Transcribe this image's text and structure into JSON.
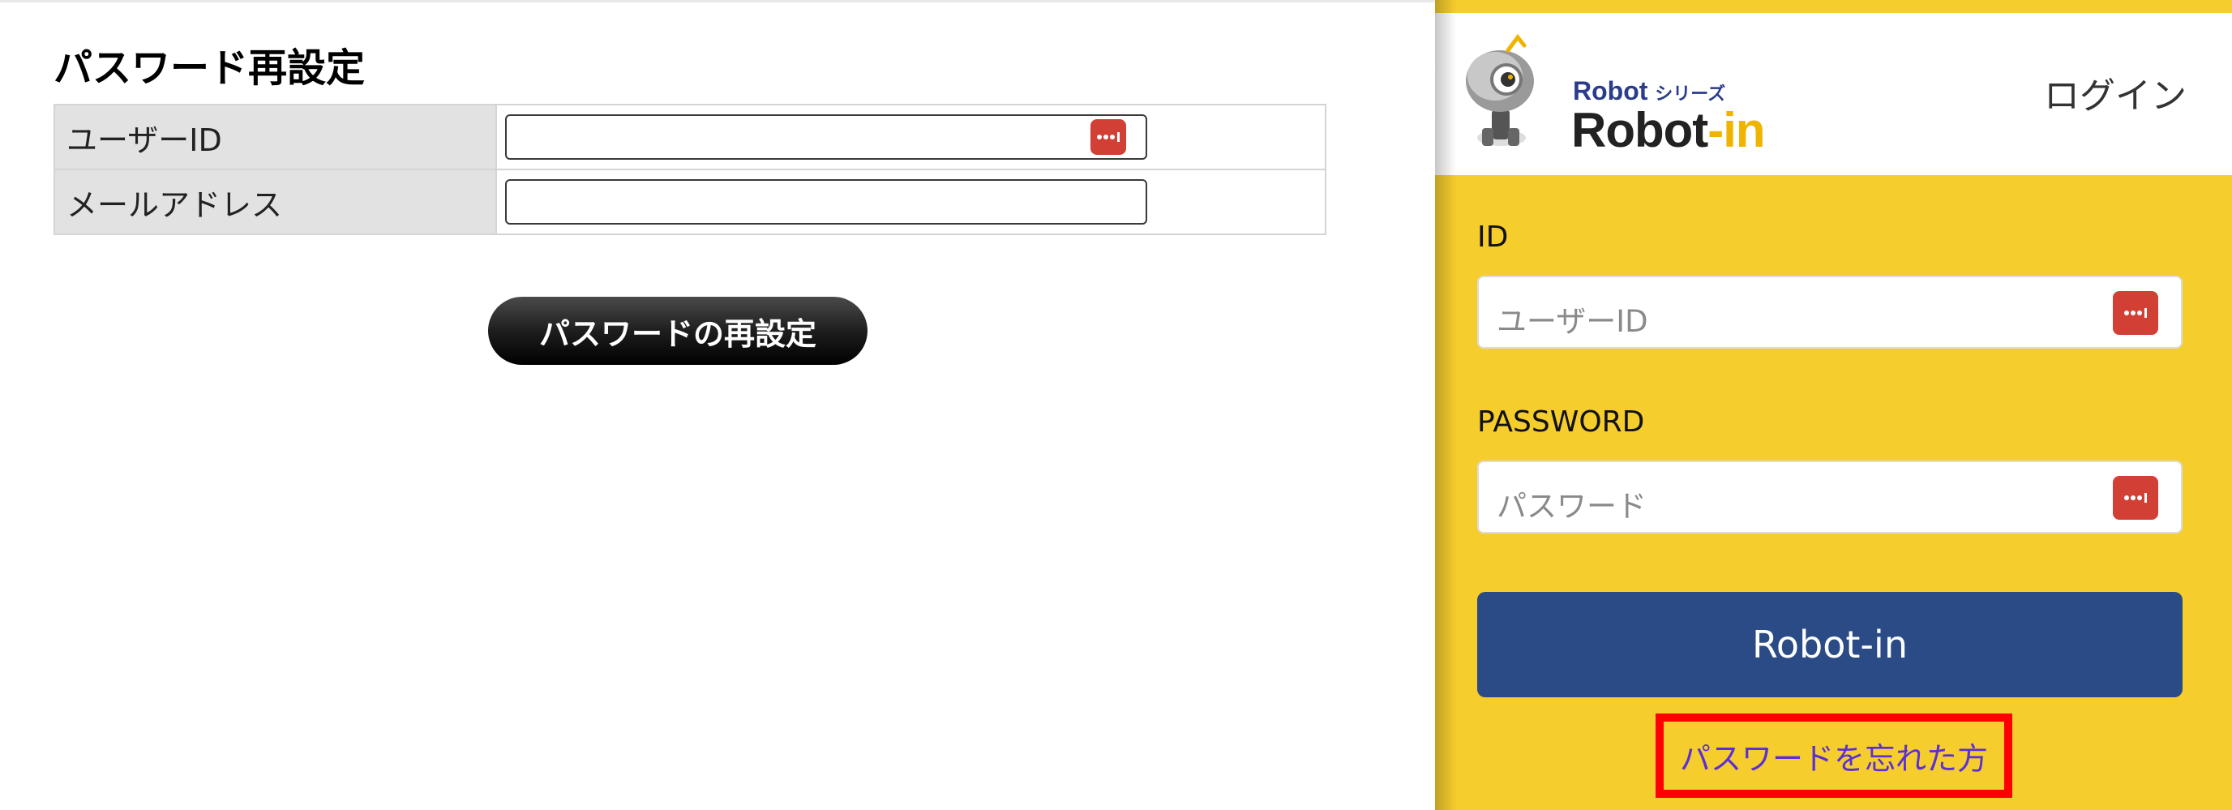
{
  "reset_form": {
    "title": "パスワード再設定",
    "fields": [
      {
        "label": "ユーザーID",
        "value": ""
      },
      {
        "label": "メールアドレス",
        "value": ""
      }
    ],
    "submit_label": "パスワードの再設定"
  },
  "login_panel": {
    "logo": {
      "series_text": "Robot",
      "series_suffix": "シリーズ",
      "name_main": "Robot",
      "name_accent": "-in"
    },
    "title": "ログイン",
    "id_label": "ID",
    "id_placeholder": "ユーザーID",
    "password_label": "PASSWORD",
    "password_placeholder": "パスワード",
    "login_button_label": "Robot-in",
    "forgot_link_label": "パスワードを忘れた方"
  },
  "colors": {
    "panel_yellow": "#f5cd2d",
    "login_button_blue": "#2a4b85",
    "password_manager_red": "#d23f35",
    "highlight_red": "#ff0000",
    "link_purple": "#5b2fd6"
  },
  "icons": {
    "password_manager": "password-manager-icon",
    "mascot": "robot-mascot-icon"
  }
}
